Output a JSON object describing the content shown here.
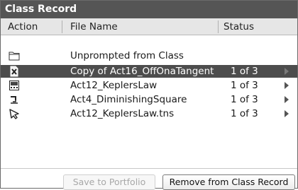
{
  "window": {
    "title": "Class Record"
  },
  "columns": {
    "action": "Action",
    "file_name": "File Name",
    "status": "Status"
  },
  "rows": [
    {
      "icon": "folder-icon",
      "name": "Unprompted from Class",
      "status": "",
      "selected": false,
      "has_arrow": false
    },
    {
      "icon": "document-x-icon",
      "name": "Copy of Act16_OffOnaTangent",
      "status": "1 of 3",
      "selected": true,
      "has_arrow": true
    },
    {
      "icon": "calculator-screen-icon",
      "name": "Act12_KeplersLaw",
      "status": "1 of 3",
      "selected": false,
      "has_arrow": true
    },
    {
      "icon": "return-arrow-icon",
      "name": "Act4_DiminishingSquare",
      "status": "1 of 3",
      "selected": false,
      "has_arrow": true
    },
    {
      "icon": "cursor-arrow-icon",
      "name": "Act12_KeplersLaw.tns",
      "status": "1 of 3",
      "selected": false,
      "has_arrow": true
    }
  ],
  "buttons": {
    "save_to_portfolio": "Save to Portfolio",
    "remove_from_class_record": "Remove from Class Record"
  },
  "colors": {
    "titlebar": "#555555",
    "selection": "#4d4d4d",
    "header": "#e6e6e6"
  }
}
